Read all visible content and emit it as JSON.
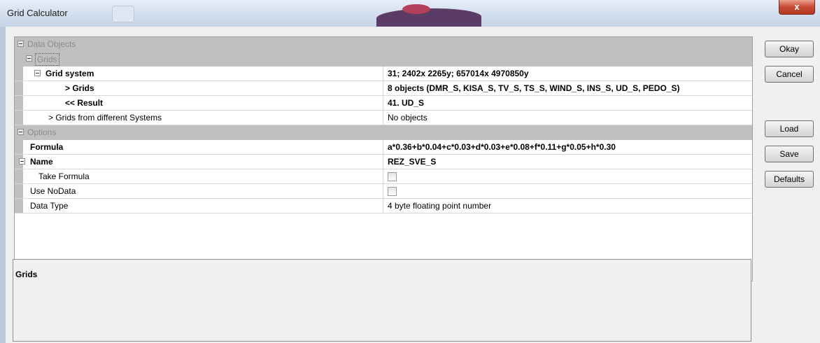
{
  "window": {
    "title": "Grid Calculator",
    "close_label": "x"
  },
  "buttons": {
    "okay": "Okay",
    "cancel": "Cancel",
    "load": "Load",
    "save": "Save",
    "defaults": "Defaults"
  },
  "sections": {
    "data_objects": "Data Objects",
    "grids": "Grids",
    "options": "Options"
  },
  "rows": {
    "grid_system": {
      "label": "Grid system",
      "value": "31; 2402x 2265y; 657014x 4970850y"
    },
    "grids": {
      "label": "> Grids",
      "value": "8 objects (DMR_S, KISA_S, TV_S, TS_S, WIND_S, INS_S, UD_S, PEDO_S)"
    },
    "result": {
      "label": "<< Result",
      "value": "41. UD_S"
    },
    "other_grids": {
      "label": "> Grids from different Systems",
      "value": "No objects"
    },
    "formula": {
      "label": "Formula",
      "value": "a*0.36+b*0.04+c*0.03+d*0.03+e*0.08+f*0.11+g*0.05+h*0.30"
    },
    "name": {
      "label": "Name",
      "value": "REZ_SVE_S"
    },
    "take_formula": {
      "label": "Take Formula",
      "checked": false
    },
    "use_nodata": {
      "label": "Use NoData",
      "checked": false
    },
    "data_type": {
      "label": "Data Type",
      "value": "4 byte floating point number"
    }
  },
  "description": {
    "title": "Grids"
  }
}
